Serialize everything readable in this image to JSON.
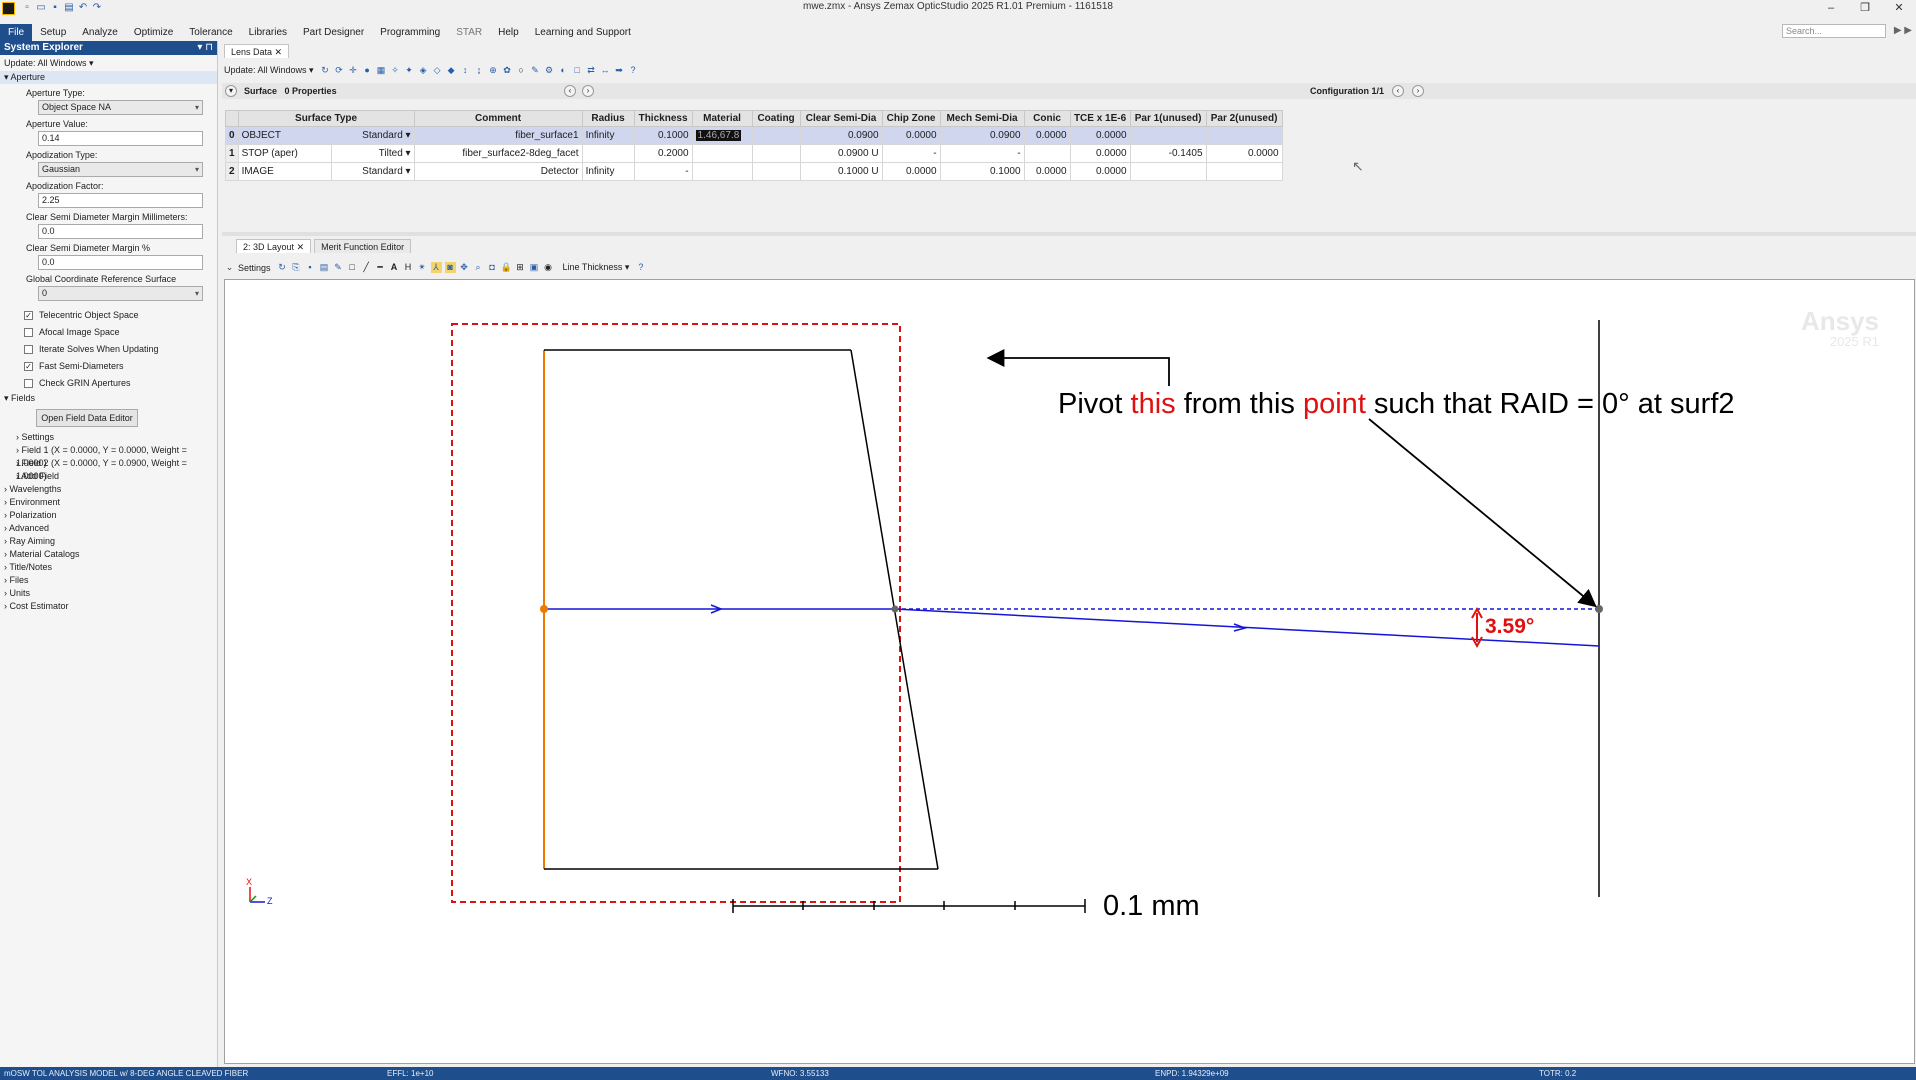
{
  "titlebar": {
    "title": "mwe.zmx - Ansys Zemax OpticStudio 2025 R1.01   Premium - 1161518",
    "minimize": "–",
    "restore": "❐",
    "close": "✕"
  },
  "menu": {
    "items": [
      "File",
      "Setup",
      "Analyze",
      "Optimize",
      "Tolerance",
      "Libraries",
      "Part Designer",
      "Programming",
      "STAR",
      "Help",
      "Learning and Support"
    ],
    "search_placeholder": "Search..."
  },
  "system_explorer": {
    "title": "System Explorer",
    "update": "Update: All Windows ▾",
    "aperture_section": "Aperture",
    "aperture_type_label": "Aperture Type:",
    "aperture_type_value": "Object Space NA",
    "aperture_value_label": "Aperture Value:",
    "aperture_value": "0.14",
    "apodization_type_label": "Apodization Type:",
    "apodization_type_value": "Gaussian",
    "apodization_factor_label": "Apodization Factor:",
    "apodization_factor_value": "2.25",
    "clear_mm_label": "Clear Semi Diameter Margin Millimeters:",
    "clear_mm_value": "0.0",
    "clear_pct_label": "Clear Semi Diameter Margin %",
    "clear_pct_value": "0.0",
    "gcrs_label": "Global Coordinate Reference Surface",
    "gcrs_value": "0",
    "checks": [
      {
        "label": "Telecentric Object Space",
        "checked": "✓"
      },
      {
        "label": "Afocal Image Space",
        "checked": ""
      },
      {
        "label": "Iterate Solves When Updating",
        "checked": ""
      },
      {
        "label": "Fast Semi-Diameters",
        "checked": "✓"
      },
      {
        "label": "Check GRIN Apertures",
        "checked": ""
      }
    ],
    "fields_section": "Fields",
    "open_field_button": "Open Field Data Editor",
    "field_items": [
      "Settings",
      "Field 1 (X = 0.0000, Y = 0.0000, Weight = 1.0000)",
      "Field 2 (X = 0.0000, Y = 0.0900, Weight = 1.0000)",
      "Add Field"
    ],
    "tree_items": [
      "Wavelengths",
      "Environment",
      "Polarization",
      "Advanced",
      "Ray Aiming",
      "Material Catalogs",
      "Title/Notes",
      "Files",
      "Units",
      "Cost Estimator"
    ]
  },
  "lens_data": {
    "tab": "Lens Data",
    "update": "Update: All Windows ▾",
    "surface_label": "Surface",
    "properties_label": "0 Properties",
    "configuration": "Configuration 1/1",
    "columns": [
      "",
      "Surface Type",
      "",
      "Comment",
      "Radius",
      "Thickness",
      "Material",
      "Coating",
      "Clear Semi-Dia",
      "Chip Zone",
      "Mech Semi-Dia",
      "Conic",
      "TCE x 1E-6",
      "Par 1(unused)",
      "Par 2(unused)"
    ],
    "rows": [
      [
        "0",
        "OBJECT",
        "Standard ▾",
        "fiber_surface1",
        "Infinity",
        "0.1000",
        "1.46,67.8",
        "",
        "0.0900",
        "0.0000",
        "0.0900",
        "0.0000",
        "0.0000",
        "",
        ""
      ],
      [
        "1",
        "STOP (aper)",
        "Tilted ▾",
        "fiber_surface2-8deg_facet",
        "",
        "0.2000",
        "",
        "",
        "0.0900 U",
        "-",
        "-",
        "",
        "0.0000",
        "-0.1405",
        "0.0000"
      ],
      [
        "2",
        "IMAGE",
        "Standard ▾",
        "Detector",
        "Infinity",
        "-",
        "",
        "",
        "0.1000 U",
        "0.0000",
        "0.1000",
        "0.0000",
        "0.0000",
        "",
        ""
      ]
    ]
  },
  "layout": {
    "tab1": "2: 3D Layout",
    "tab2": "Merit Function Editor",
    "settings": "Settings",
    "line_thickness": "Line Thickness ▾",
    "watermark_line1": "Ansys",
    "watermark_line2": "2025 R1",
    "annotation_parts": [
      "Pivot ",
      "this",
      " from this ",
      "point",
      " such that RAID = 0° at surf2"
    ],
    "angle_label": "3.59°",
    "scale_label": "0.1 mm",
    "axis_x": "X",
    "axis_z": "Z",
    "colors": {
      "ray": "#1515d8",
      "red": "#e01010",
      "surface": "#000000",
      "object": "#f07a00"
    }
  },
  "status": {
    "model": "mOSW TOL ANALYSIS MODEL w/ 8-DEG ANGLE CLEAVED FIBER",
    "effl": "EFFL: 1e+10",
    "wfno": "WFNO: 3.55133",
    "enpd": "ENPD: 1.94329e+09",
    "totr": "TOTR: 0.2"
  }
}
